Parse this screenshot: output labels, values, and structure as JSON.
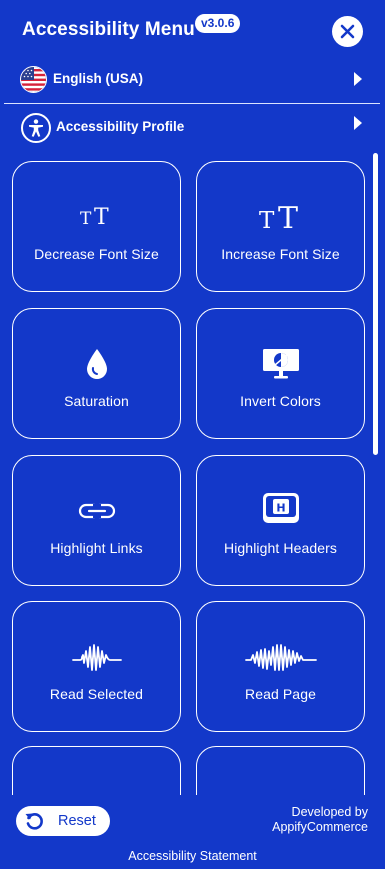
{
  "header": {
    "title": "Accessibility Menu",
    "version": "v3.0.6",
    "close_icon": "close-icon"
  },
  "language": {
    "label": "English (USA)",
    "flag_icon": "us-flag-icon",
    "arrow_icon": "caret-right-icon"
  },
  "profile": {
    "label": "Accessibility Profile",
    "icon": "accessibility-person-icon",
    "arrow_icon": "caret-right-icon"
  },
  "tiles": [
    {
      "label": "Decrease Font Size",
      "icon": "decrease-font-icon"
    },
    {
      "label": "Increase Font Size",
      "icon": "increase-font-icon"
    },
    {
      "label": "Saturation",
      "icon": "droplet-icon"
    },
    {
      "label": "Invert Colors",
      "icon": "monitor-invert-icon"
    },
    {
      "label": "Highlight Links",
      "icon": "link-icon"
    },
    {
      "label": "Highlight Headers",
      "icon": "heading-h-icon"
    },
    {
      "label": "Read Selected",
      "icon": "waveform-icon"
    },
    {
      "label": "Read Page",
      "icon": "waveform-wide-icon"
    },
    {
      "label": "",
      "icon": "text-align-icon"
    },
    {
      "label": "",
      "icon": ""
    }
  ],
  "footer": {
    "reset_label": "Reset",
    "reset_icon": "reset-icon",
    "developed_by": "Developed by",
    "developer": "AppifyCommerce",
    "statement": "Accessibility Statement"
  },
  "colors": {
    "background": "#1338c9",
    "foreground": "#ffffff"
  }
}
